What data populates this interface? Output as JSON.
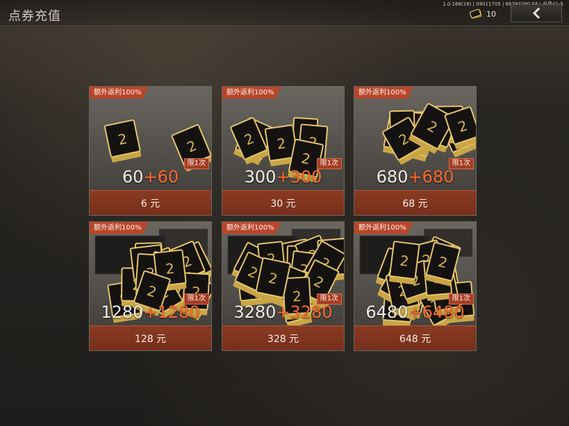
{
  "header": {
    "title": "点券充值",
    "version": "1.0.166(18) | 09011705 | 66784290 58 | 品质41-5",
    "currency": {
      "icon": "coupon-icon",
      "count": "10"
    },
    "back_icon": "back-arrow-icon"
  },
  "packages": [
    {
      "bonus_tag": "额外返利100%",
      "limit": "限1次",
      "base": "60",
      "extra": "+60",
      "price": "6 元"
    },
    {
      "bonus_tag": "额外返利100%",
      "limit": "限1次",
      "base": "300",
      "extra": "+300",
      "price": "30 元"
    },
    {
      "bonus_tag": "额外返利100%",
      "limit": "限1次",
      "base": "680",
      "extra": "+680",
      "price": "68 元"
    },
    {
      "bonus_tag": "额外返利100%",
      "limit": "限1次",
      "base": "1280",
      "extra": "+1280",
      "price": "128 元"
    },
    {
      "bonus_tag": "额外返利100%",
      "limit": "限1次",
      "base": "3280",
      "extra": "+3280",
      "price": "328 元"
    },
    {
      "bonus_tag": "额外返利100%",
      "limit": "限1次",
      "base": "6480",
      "extra": "+6480",
      "price": "648 元"
    }
  ],
  "colors": {
    "bonus_tag": "#b8462a",
    "price_bar": "#7f341f",
    "extra_amount": "#ff6a2c"
  }
}
